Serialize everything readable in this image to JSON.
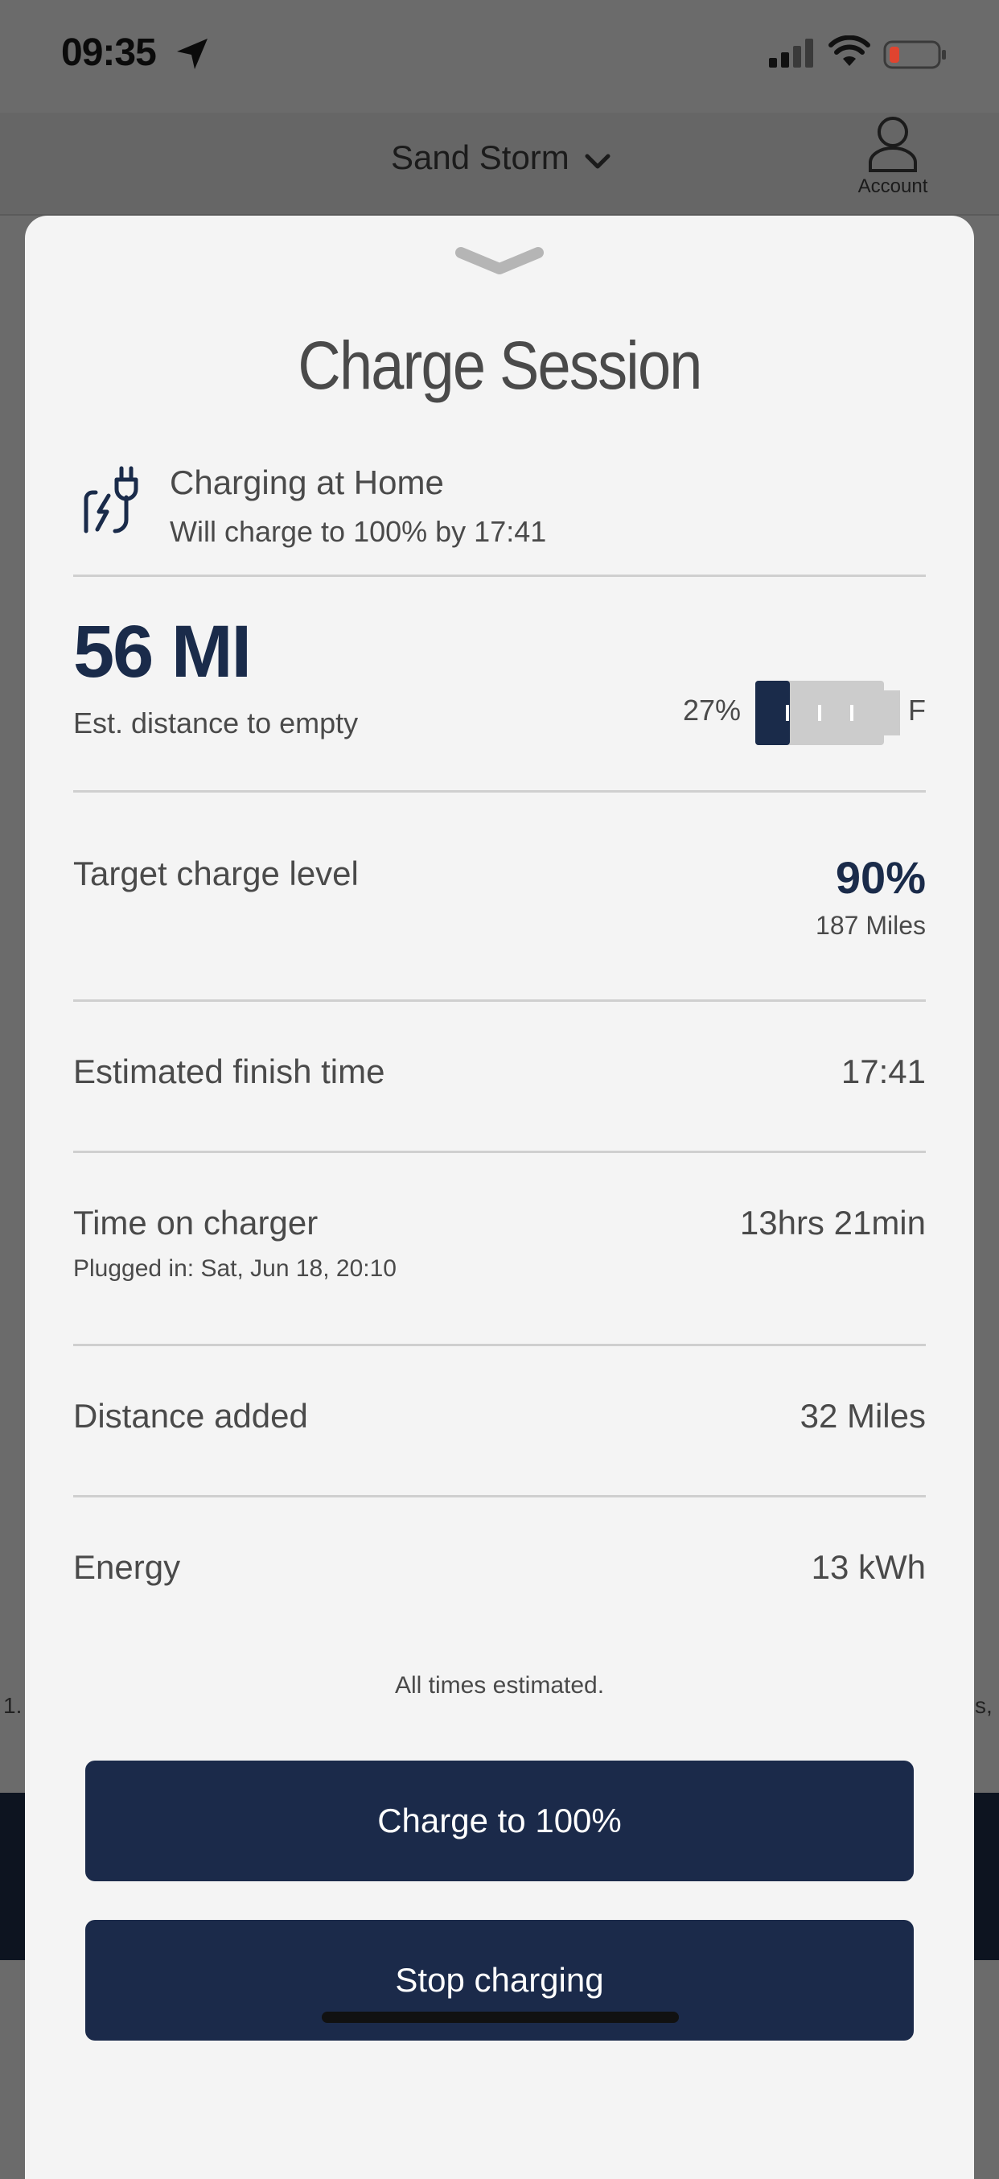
{
  "status_bar": {
    "time": "09:35",
    "icons": [
      "location-arrow-icon",
      "cellular-signal-icon",
      "wifi-icon",
      "battery-low-icon"
    ]
  },
  "header": {
    "vehicle_name": "Sand Storm",
    "account_label": "Account"
  },
  "background_fragments": {
    "left": "1.",
    "right": "s,"
  },
  "sheet": {
    "title": "Charge Session",
    "charging": {
      "icon": "plug-lightning-icon",
      "title": "Charging at Home",
      "subtitle": "Will charge to 100% by 17:41"
    },
    "range": {
      "value": "56 MI",
      "label": "Est. distance to empty",
      "battery_percent_text": "27%",
      "battery_level": 0.27,
      "full_label": "F"
    },
    "rows": [
      {
        "label": "Target charge level",
        "value": "90%",
        "sub_value": "187 Miles"
      },
      {
        "label": "Estimated finish time",
        "value": "17:41"
      },
      {
        "label": "Time on charger",
        "value": "13hrs 21min",
        "sub_label": "Plugged in: Sat, Jun 18, 20:10"
      },
      {
        "label": "Distance added",
        "value": "32 Miles"
      },
      {
        "label": "Energy",
        "value": "13 kWh"
      }
    ],
    "footnote": "All times estimated.",
    "buttons": {
      "charge_full": "Charge to 100%",
      "stop": "Stop charging"
    }
  },
  "colors": {
    "accent": "#1b2a4a",
    "sheet_bg": "#f4f4f4",
    "text": "#4a4a4a",
    "battery_fill": "#1a2b4a",
    "battery_empty": "#cccccc"
  }
}
